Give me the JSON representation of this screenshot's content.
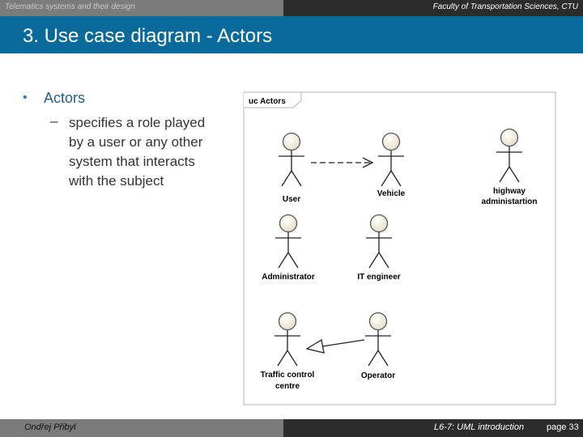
{
  "header": {
    "course": "Telematics systems and their design",
    "faculty": "Faculty of Transportation Sciences, CTU"
  },
  "slide_title": "3. Use case diagram - Actors",
  "bullet": {
    "heading": "Actors",
    "sub_dash": "–",
    "sub_text": "specifies a role played by a user or any other system that interacts with the subject"
  },
  "diagram": {
    "frame_label": "uc Actors",
    "actors": {
      "user": "User",
      "vehicle": "Vehicle",
      "highway_line1": "highway",
      "highway_line2": "administartion",
      "administrator": "Administrator",
      "it_engineer": "IT engineer",
      "traffic_line1": "Traffic control",
      "traffic_line2": "centre",
      "operator": "Operator"
    }
  },
  "footer": {
    "author": "Ondřej Přibyl",
    "lecture": "L6-7: UML introduction",
    "page": "page 33"
  },
  "colors": {
    "title_bar": "#0b6a9c",
    "actor_head": "#f3eedc"
  }
}
